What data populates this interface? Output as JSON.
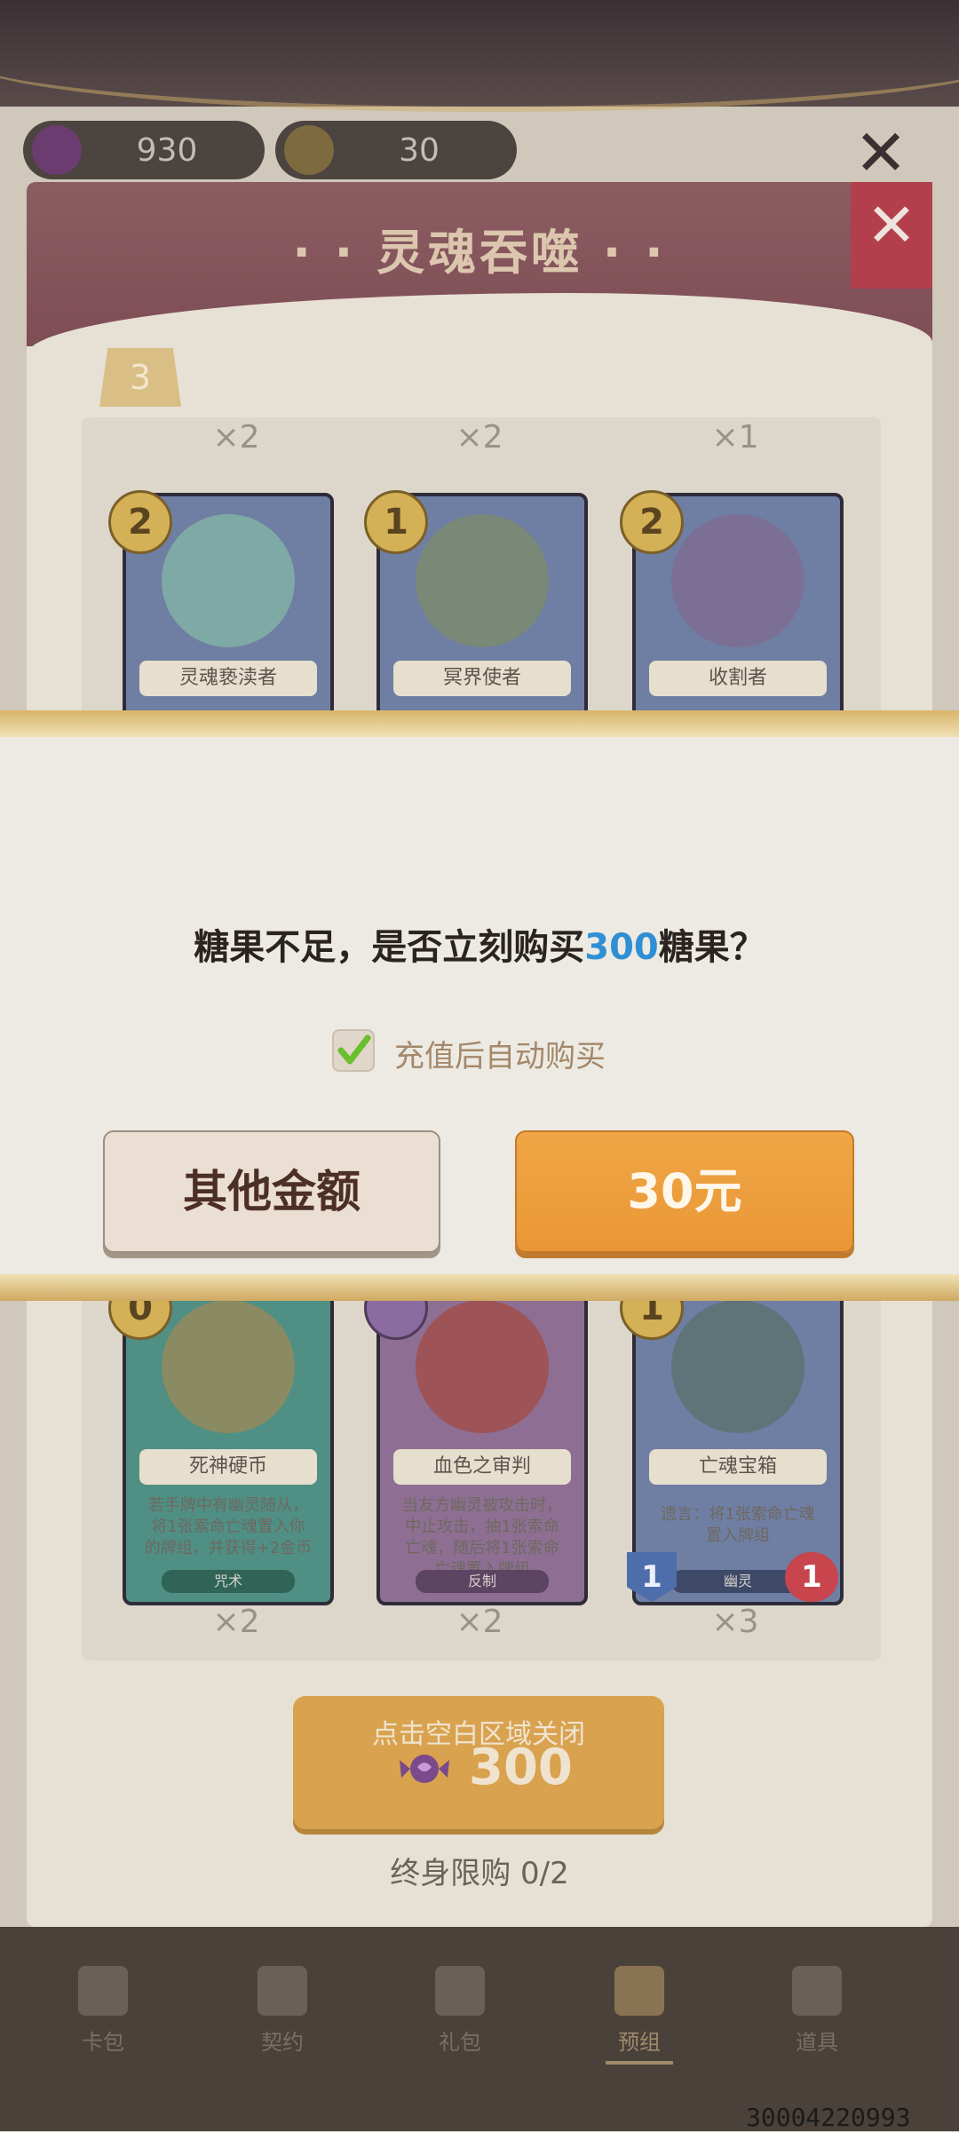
{
  "header": {
    "soul_currency": "930",
    "gold_currency": "30"
  },
  "panel": {
    "title": "· · 灵魂吞噬 · ·",
    "pack_level": "3",
    "cards_top": [
      {
        "count": "×2",
        "cost": "2",
        "name": "灵魂亵渎者"
      },
      {
        "count": "×2",
        "cost": "1",
        "name": "冥界使者"
      },
      {
        "count": "×1",
        "cost": "2",
        "name": "收割者"
      }
    ],
    "cards_bottom": [
      {
        "count": "×2",
        "cost": "0",
        "name": "死神硬币",
        "desc": "若手牌中有幽灵随从，将1张索命亡魂置入你的牌组，并获得+2金币",
        "type": "咒术"
      },
      {
        "count": "×2",
        "cost": "",
        "name": "血色之审判",
        "desc": "当友方幽灵被攻击时，中止攻击，抽1张索命亡魂，随后将1张索命亡魂置入牌组",
        "type": "反制"
      },
      {
        "count": "×3",
        "cost": "1",
        "name": "亡魂宝箱",
        "desc": "遗言：将1张索命亡魂置入牌组",
        "type": "幽灵",
        "attack": "1",
        "health": "1"
      }
    ],
    "buy_hint": "点击空白区域关闭",
    "buy_price": "300",
    "limit_text": "终身限购 0/2"
  },
  "bottom_nav": [
    {
      "label": "卡包"
    },
    {
      "label": "契约"
    },
    {
      "label": "礼包"
    },
    {
      "label": "预组"
    },
    {
      "label": "道具"
    }
  ],
  "dialog": {
    "msg_prefix": "糖果不足，是否立刻购买",
    "msg_amount": "300",
    "msg_suffix": "糖果？",
    "checkbox_label": "充值后自动购买",
    "checkbox_checked": true,
    "other_amount_button": "其他金额",
    "pay_button": "30元"
  },
  "footer": {
    "build_id": "30004220993"
  },
  "colors": {
    "accent_blue": "#2f8fd4",
    "pay_orange": "#ea9a38",
    "checkbox_green": "#6abf2e"
  }
}
